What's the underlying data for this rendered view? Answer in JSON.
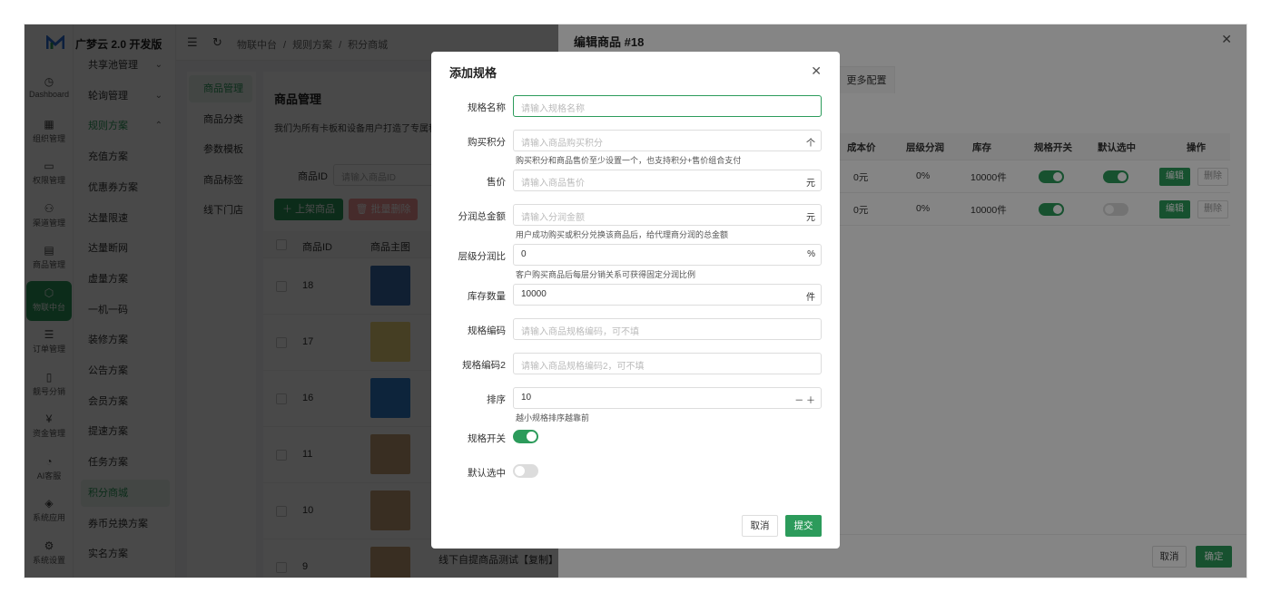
{
  "app": {
    "brand": "广梦云 2.0 开发版"
  },
  "rail": [
    {
      "label": "Dashboard",
      "icon": "dashboard-icon",
      "glyph": "◷"
    },
    {
      "label": "组织管理",
      "icon": "org-icon",
      "glyph": "▦"
    },
    {
      "label": "权限管理",
      "icon": "monitor-icon",
      "glyph": "▭"
    },
    {
      "label": "渠道管理",
      "icon": "channel-icon",
      "glyph": "⚇"
    },
    {
      "label": "商品管理",
      "icon": "shop-icon",
      "glyph": "▤"
    },
    {
      "label": "物联中台",
      "icon": "iot-icon",
      "glyph": "⬡",
      "active": true
    },
    {
      "label": "订单管理",
      "icon": "list-icon",
      "glyph": "☰"
    },
    {
      "label": "靓号分销",
      "icon": "phone-icon",
      "glyph": "▯"
    },
    {
      "label": "资金管理",
      "icon": "wallet-icon",
      "glyph": "¥"
    },
    {
      "label": "AI客服",
      "icon": "ai-icon",
      "glyph": "◔"
    },
    {
      "label": "系统应用",
      "icon": "cube-icon",
      "glyph": "◈"
    },
    {
      "label": "系统设置",
      "icon": "settings-icon",
      "glyph": "⚙"
    }
  ],
  "subnav": [
    {
      "label": "共享池管理",
      "chev": "⌄"
    },
    {
      "label": "轮询管理",
      "chev": "⌄"
    },
    {
      "label": "规则方案",
      "chev": "⌃",
      "open": true
    },
    {
      "label": "充值方案"
    },
    {
      "label": "优惠券方案"
    },
    {
      "label": "达量限速"
    },
    {
      "label": "达量断网"
    },
    {
      "label": "虚量方案"
    },
    {
      "label": "一机一码"
    },
    {
      "label": "装修方案"
    },
    {
      "label": "公告方案"
    },
    {
      "label": "会员方案"
    },
    {
      "label": "提速方案"
    },
    {
      "label": "任务方案"
    },
    {
      "label": "积分商城",
      "active": true
    },
    {
      "label": "券币兑换方案"
    },
    {
      "label": "实名方案"
    }
  ],
  "header": {
    "breadcrumb": [
      "物联中台",
      "/",
      "规则方案",
      "/",
      "积分商城"
    ]
  },
  "tertiary": [
    {
      "label": "商品管理",
      "active": true
    },
    {
      "label": "商品分类"
    },
    {
      "label": "参数模板"
    },
    {
      "label": "商品标签"
    },
    {
      "label": "线下门店"
    }
  ],
  "card": {
    "title": "商品管理",
    "desc": "我们为所有卡板和设备用户打造了专属积",
    "pid_label": "商品ID",
    "pid_placeholder": "请输入商品ID",
    "add_btn": "＋ 上架商品",
    "del_btn": "🗑 批量删除",
    "cols": [
      "商品ID",
      "商品主图"
    ],
    "rows": [
      {
        "id": "18",
        "img": "#3b6fb0"
      },
      {
        "id": "17",
        "img": "#f0d97a"
      },
      {
        "id": "16",
        "img": "#2f7fd0"
      },
      {
        "id": "11",
        "img": "#c8a078"
      },
      {
        "id": "10",
        "img": "#c8a078"
      },
      {
        "id": "9",
        "img": "#c8a078"
      }
    ],
    "row9_name": "线下自提商品测试【复制】【复"
  },
  "drawer": {
    "title": "编辑商品 #18",
    "tab": "更多配置",
    "cols": [
      "成本价",
      "层级分润",
      "库存",
      "规格开关",
      "默认选中",
      "操作"
    ],
    "rows": [
      {
        "cost": "0元",
        "share": "0%",
        "stock": "10000件",
        "enabled": true,
        "default": true
      },
      {
        "cost": "0元",
        "share": "0%",
        "stock": "10000件",
        "enabled": true,
        "default": false
      }
    ],
    "edit": "编辑",
    "remove": "删除",
    "cancel": "取消",
    "ok": "确定"
  },
  "dialog": {
    "title": "添加规格",
    "fields": {
      "name": {
        "label": "规格名称",
        "placeholder": "请输入规格名称"
      },
      "points": {
        "label": "购买积分",
        "placeholder": "请输入商品购买积分",
        "suffix": "个",
        "hint": "购买积分和商品售价至少设置一个，也支持积分+售价组合支付"
      },
      "price": {
        "label": "售价",
        "placeholder": "请输入商品售价",
        "suffix": "元"
      },
      "commission": {
        "label": "分润总金额",
        "placeholder": "请输入分润金额",
        "suffix": "元",
        "hint": "用户成功购买或积分兑换该商品后，给代理商分润的总金额"
      },
      "ratio": {
        "label": "层级分润比",
        "value": "0",
        "suffix": "%",
        "hint": "客户购买商品后每层分销关系可获得固定分润比例"
      },
      "stock": {
        "label": "库存数量",
        "value": "10000",
        "suffix": "件"
      },
      "code": {
        "label": "规格编码",
        "placeholder": "请输入商品规格编码，可不填"
      },
      "code2": {
        "label": "规格编码2",
        "placeholder": "请输入商品规格编码2，可不填"
      },
      "sort": {
        "label": "排序",
        "value": "10",
        "suffix": "－ ＋",
        "hint": "越小规格排序越靠前"
      },
      "enabled": {
        "label": "规格开关",
        "on": true
      },
      "default": {
        "label": "默认选中",
        "on": false
      }
    },
    "cancel": "取消",
    "submit": "提交"
  },
  "colors": {
    "accent": "#2c9b5b"
  }
}
